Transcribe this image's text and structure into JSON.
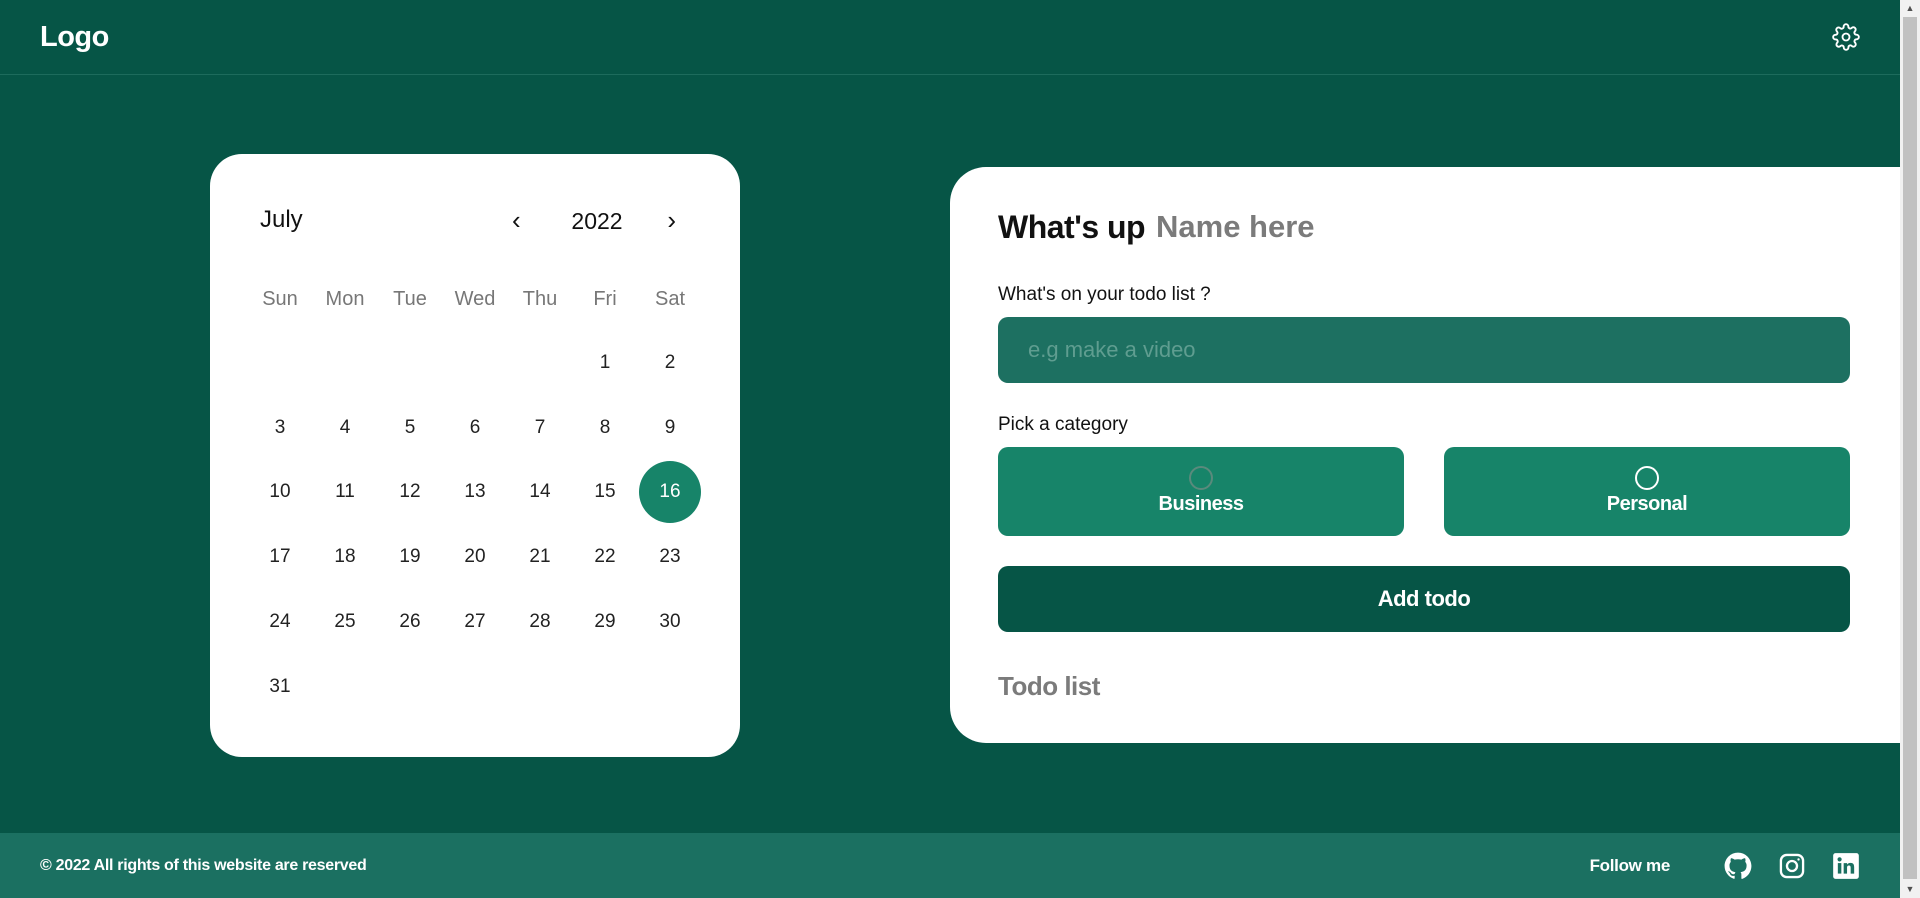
{
  "header": {
    "logo": "Logo",
    "settings_icon": "gear-icon"
  },
  "calendar": {
    "month": "July",
    "year": "2022",
    "prev_label": "‹",
    "next_label": "›",
    "weekdays": [
      "Sun",
      "Mon",
      "Tue",
      "Wed",
      "Thu",
      "Fri",
      "Sat"
    ],
    "days": [
      "1",
      "2",
      "3",
      "4",
      "5",
      "6",
      "7",
      "8",
      "9",
      "10",
      "11",
      "12",
      "13",
      "14",
      "15",
      "16",
      "17",
      "18",
      "19",
      "20",
      "21",
      "22",
      "23",
      "24",
      "25",
      "26",
      "27",
      "28",
      "29",
      "30",
      "31"
    ],
    "selected_day": "16",
    "accent_color": "#178469"
  },
  "todo": {
    "greeting": "What's up",
    "name_placeholder": "Name here",
    "todo_label": "What's on your todo list ?",
    "todo_placeholder": "e.g make a video",
    "category_label": "Pick a category",
    "categories": [
      {
        "label": "Business"
      },
      {
        "label": "Personal"
      }
    ],
    "add_button": "Add todo",
    "list_title": "Todo list"
  },
  "footer": {
    "copyright": "© 2022 All rights of this website are reserved",
    "follow_label": "Follow me",
    "social_icons": [
      "github-icon",
      "instagram-icon",
      "linkedin-icon"
    ]
  },
  "colors": {
    "background": "#065546",
    "card": "#ffffff",
    "input": "#1d7061",
    "category": "#178469",
    "footer": "#1b7061"
  }
}
